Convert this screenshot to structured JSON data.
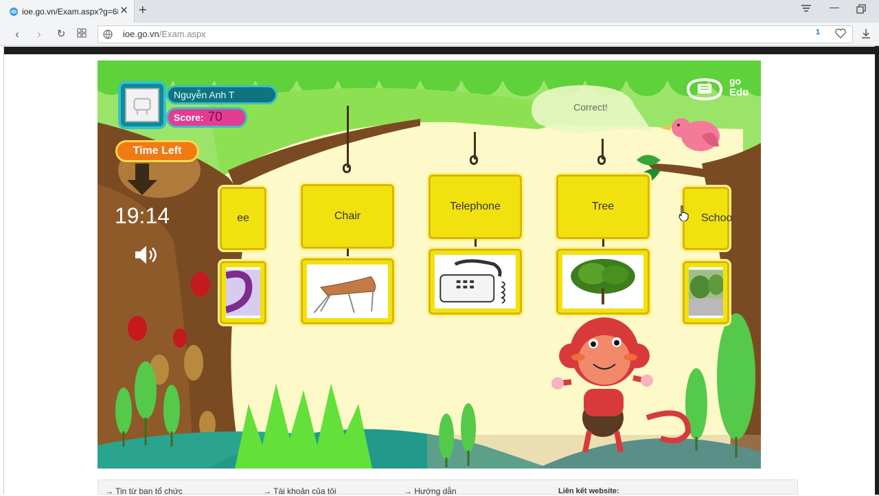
{
  "browser": {
    "tab_title": "ioe.go.vn/Exam.aspx?g=68",
    "url_host": "ioe.go.vn",
    "url_path": "/Exam.aspx",
    "ext_badge": "1"
  },
  "game": {
    "player_name": "Nguyễn Anh T",
    "score_label": "Score:",
    "score_value": "70",
    "time_left_label": "Time Left",
    "timer": "19:14",
    "feedback": "Correct!",
    "logo_text_top": "go",
    "logo_text_bottom": "Edu",
    "word_cards": [
      "ee",
      "Chair",
      "Telephone",
      "Tree",
      "Schoo"
    ]
  },
  "footer": {
    "link1": "→ Tin từ ban tổ chức",
    "link2": "→ Tài khoản của tôi",
    "link3": "→ Hướng dẫn",
    "links_title": "Liên kết website:"
  },
  "colors": {
    "grass_green": "#9be46a",
    "card_yellow": "#f1e20f",
    "name_teal": "#117381",
    "score_pink": "#e43c91",
    "time_orange": "#f07a14"
  }
}
